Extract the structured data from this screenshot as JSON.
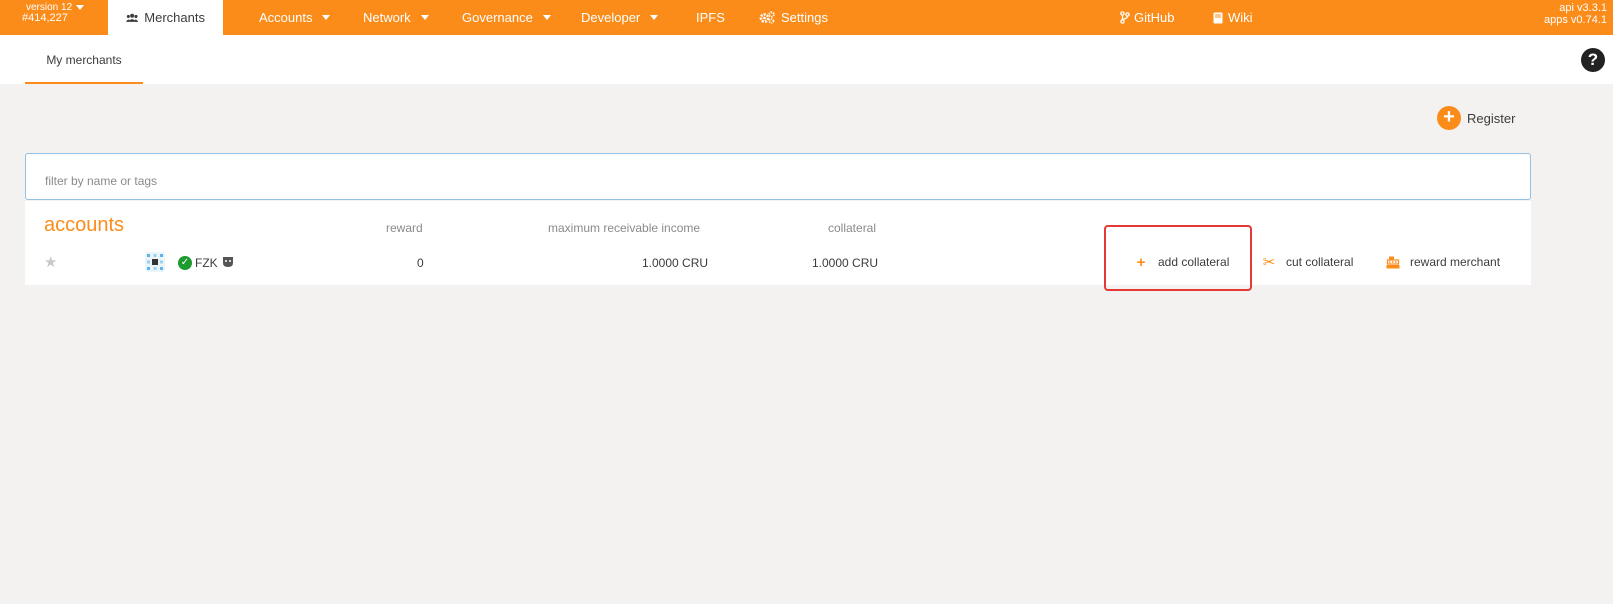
{
  "chain": {
    "version": "version 12",
    "block": "#414,227"
  },
  "nav": {
    "merchants": "Merchants",
    "accounts": "Accounts",
    "network": "Network",
    "governance": "Governance",
    "developer": "Developer",
    "ipfs": "IPFS",
    "settings": "Settings",
    "github": "GitHub",
    "wiki": "Wiki"
  },
  "api": {
    "api_version": "api v3.3.1",
    "apps_version": "apps v0.74.1"
  },
  "tabs": {
    "my_merchants": "My merchants"
  },
  "help": "?",
  "register": {
    "label": "Register"
  },
  "filter": {
    "placeholder": "filter by name or tags",
    "value": ""
  },
  "table": {
    "headers": {
      "accounts": "accounts",
      "reward": "reward",
      "max_income": "maximum receivable income",
      "collateral": "collateral"
    },
    "rows": [
      {
        "name": "FZK",
        "reward": "0",
        "max_income": "1.0000 CRU",
        "collateral": "1.0000 CRU"
      }
    ]
  },
  "actions": {
    "add_collateral": "add collateral",
    "cut_collateral": "cut collateral",
    "reward_merchant": "reward merchant"
  },
  "colors": {
    "accent": "#fb8c1a",
    "highlight": "#e53935",
    "verified": "#1d9b2f"
  },
  "icons": [
    "users-icon",
    "gears-icon",
    "fork-icon",
    "book-icon",
    "help-icon",
    "plus-icon",
    "scissors-icon",
    "cash-register-icon",
    "star-icon",
    "identicon",
    "check-icon",
    "badge-icon"
  ]
}
